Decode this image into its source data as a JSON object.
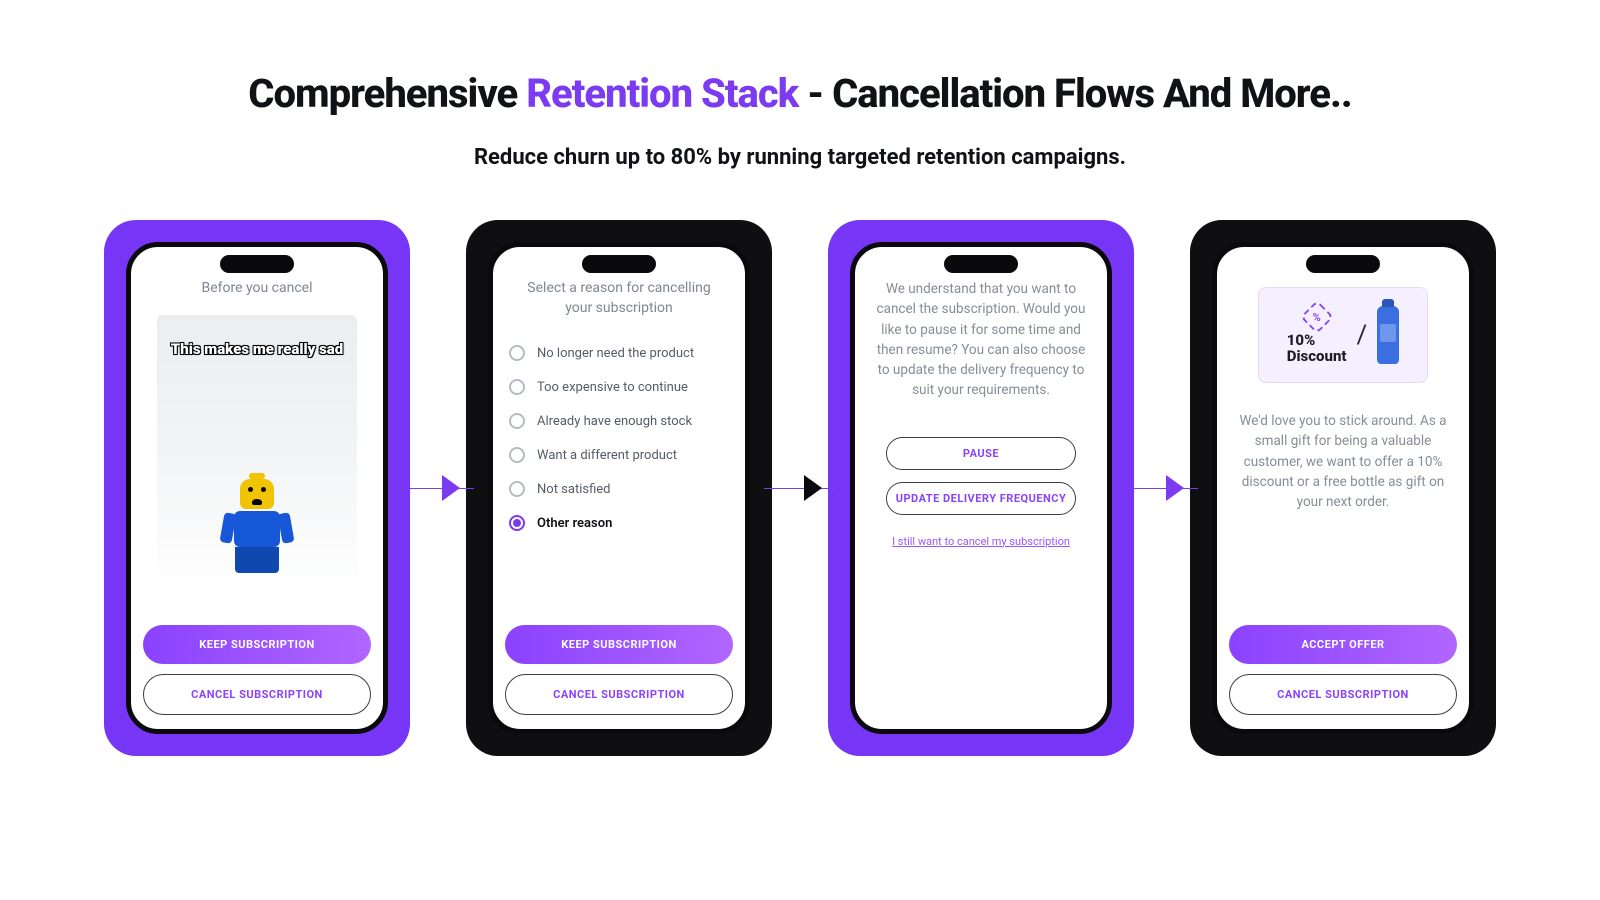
{
  "headline": {
    "pre": "Comprehensive ",
    "accent": "Retention Stack",
    "post": " - Cancellation Flows And More.."
  },
  "subhead": "Reduce churn up to 80% by running targeted retention campaigns.",
  "colors": {
    "accent": "#7B3BF0",
    "dark": "#0F0F12"
  },
  "cards": [
    {
      "bg": "purple",
      "title": "Before you cancel",
      "meme_text": "This makes me really sad",
      "primary": "KEEP SUBSCRIPTION",
      "secondary": "CANCEL SUBSCRIPTION"
    },
    {
      "bg": "black",
      "title": "Select a reason for cancelling your subscription",
      "options": [
        {
          "label": "No longer need the product",
          "selected": false
        },
        {
          "label": "Too expensive to continue",
          "selected": false
        },
        {
          "label": "Already have enough stock",
          "selected": false
        },
        {
          "label": "Want a different product",
          "selected": false
        },
        {
          "label": "Not satisfied",
          "selected": false
        },
        {
          "label": "Other reason",
          "selected": true
        }
      ],
      "primary": "KEEP SUBSCRIPTION",
      "secondary": "CANCEL SUBSCRIPTION"
    },
    {
      "bg": "purple",
      "body": "We understand that you want to cancel the subscription. Would you like to pause it for some time and then resume? You can also choose to update the delivery frequency to suit your requirements.",
      "pause": "PAUSE",
      "update": "UPDATE DELIVERY FREQUENCY",
      "cancel_link": "I still want to cancel my subscription"
    },
    {
      "bg": "black",
      "offer_line1": "10%",
      "offer_line2": "Discount",
      "body": "We'd love you to stick around. As a small gift for being a valuable customer, we want to offer a 10% discount or a free bottle as gift on your next order.",
      "primary": "ACCEPT OFFER",
      "secondary": "CANCEL SUBSCRIPTION"
    }
  ]
}
